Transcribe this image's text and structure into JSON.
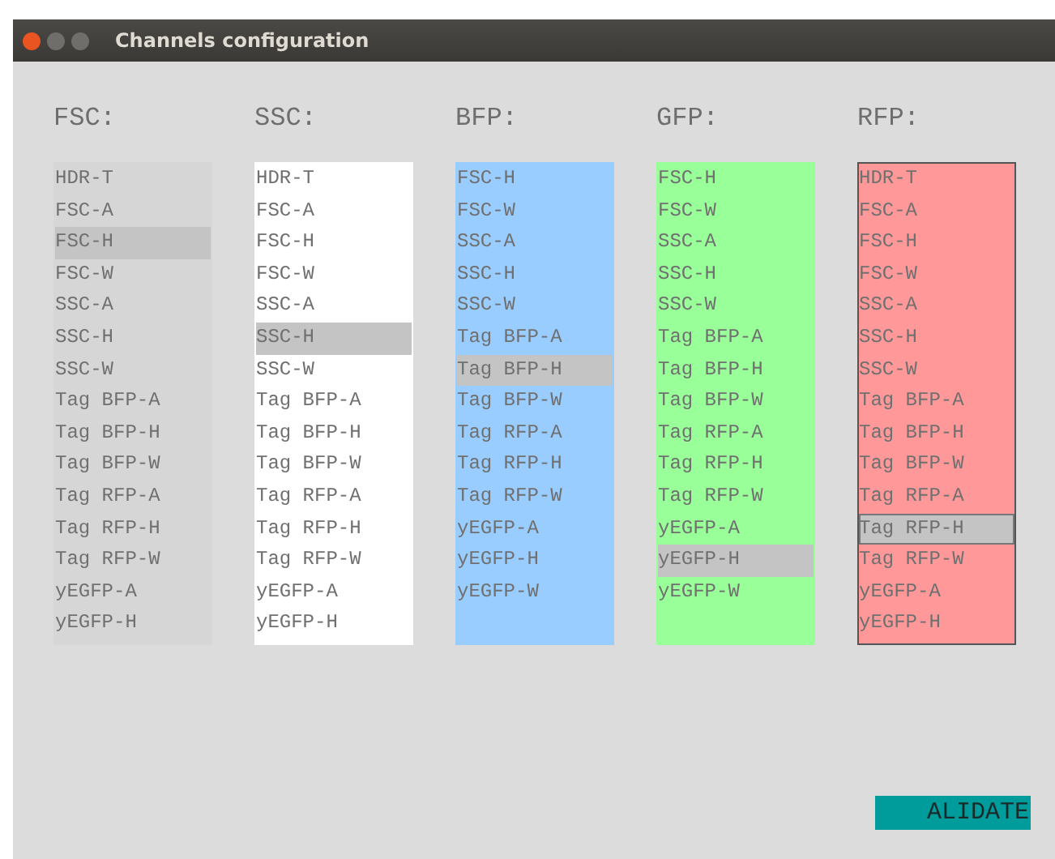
{
  "window": {
    "title": "Channels configuration"
  },
  "lists": [
    {
      "header": "FSC:",
      "color": "#d6d6d6",
      "focused": false,
      "items": [
        {
          "label": "HDR-T",
          "selected": false
        },
        {
          "label": "FSC-A",
          "selected": false
        },
        {
          "label": "FSC-H",
          "selected": true
        },
        {
          "label": "FSC-W",
          "selected": false
        },
        {
          "label": "SSC-A",
          "selected": false
        },
        {
          "label": "SSC-H",
          "selected": false
        },
        {
          "label": "SSC-W",
          "selected": false
        },
        {
          "label": "Tag BFP-A",
          "selected": false
        },
        {
          "label": "Tag BFP-H",
          "selected": false
        },
        {
          "label": "Tag BFP-W",
          "selected": false
        },
        {
          "label": "Tag RFP-A",
          "selected": false
        },
        {
          "label": "Tag RFP-H",
          "selected": false
        },
        {
          "label": "Tag RFP-W",
          "selected": false
        },
        {
          "label": "yEGFP-A",
          "selected": false
        },
        {
          "label": "yEGFP-H",
          "selected": false
        }
      ]
    },
    {
      "header": "SSC:",
      "color": "#ffffff",
      "focused": false,
      "items": [
        {
          "label": "HDR-T",
          "selected": false
        },
        {
          "label": "FSC-A",
          "selected": false
        },
        {
          "label": "FSC-H",
          "selected": false
        },
        {
          "label": "FSC-W",
          "selected": false
        },
        {
          "label": "SSC-A",
          "selected": false
        },
        {
          "label": "SSC-H",
          "selected": true
        },
        {
          "label": "SSC-W",
          "selected": false
        },
        {
          "label": "Tag BFP-A",
          "selected": false
        },
        {
          "label": "Tag BFP-H",
          "selected": false
        },
        {
          "label": "Tag BFP-W",
          "selected": false
        },
        {
          "label": "Tag RFP-A",
          "selected": false
        },
        {
          "label": "Tag RFP-H",
          "selected": false
        },
        {
          "label": "Tag RFP-W",
          "selected": false
        },
        {
          "label": "yEGFP-A",
          "selected": false
        },
        {
          "label": "yEGFP-H",
          "selected": false
        }
      ]
    },
    {
      "header": "BFP:",
      "color": "#99ccff",
      "focused": false,
      "items": [
        {
          "label": "FSC-H",
          "selected": false
        },
        {
          "label": "FSC-W",
          "selected": false
        },
        {
          "label": "SSC-A",
          "selected": false
        },
        {
          "label": "SSC-H",
          "selected": false
        },
        {
          "label": "SSC-W",
          "selected": false
        },
        {
          "label": "Tag BFP-A",
          "selected": false
        },
        {
          "label": "Tag BFP-H",
          "selected": true
        },
        {
          "label": "Tag BFP-W",
          "selected": false
        },
        {
          "label": "Tag RFP-A",
          "selected": false
        },
        {
          "label": "Tag RFP-H",
          "selected": false
        },
        {
          "label": "Tag RFP-W",
          "selected": false
        },
        {
          "label": "yEGFP-A",
          "selected": false
        },
        {
          "label": "yEGFP-H",
          "selected": false
        },
        {
          "label": "yEGFP-W",
          "selected": false
        }
      ]
    },
    {
      "header": "GFP:",
      "color": "#99ff99",
      "focused": false,
      "items": [
        {
          "label": "FSC-H",
          "selected": false
        },
        {
          "label": "FSC-W",
          "selected": false
        },
        {
          "label": "SSC-A",
          "selected": false
        },
        {
          "label": "SSC-H",
          "selected": false
        },
        {
          "label": "SSC-W",
          "selected": false
        },
        {
          "label": "Tag BFP-A",
          "selected": false
        },
        {
          "label": "Tag BFP-H",
          "selected": false
        },
        {
          "label": "Tag BFP-W",
          "selected": false
        },
        {
          "label": "Tag RFP-A",
          "selected": false
        },
        {
          "label": "Tag RFP-H",
          "selected": false
        },
        {
          "label": "Tag RFP-W",
          "selected": false
        },
        {
          "label": "yEGFP-A",
          "selected": false
        },
        {
          "label": "yEGFP-H",
          "selected": true
        },
        {
          "label": "yEGFP-W",
          "selected": false
        }
      ]
    },
    {
      "header": "RFP:",
      "color": "#ff9999",
      "focused": true,
      "items": [
        {
          "label": "HDR-T",
          "selected": false
        },
        {
          "label": "FSC-A",
          "selected": false
        },
        {
          "label": "FSC-H",
          "selected": false
        },
        {
          "label": "FSC-W",
          "selected": false
        },
        {
          "label": "SSC-A",
          "selected": false
        },
        {
          "label": "SSC-H",
          "selected": false
        },
        {
          "label": "SSC-W",
          "selected": false
        },
        {
          "label": "Tag BFP-A",
          "selected": false
        },
        {
          "label": "Tag BFP-H",
          "selected": false
        },
        {
          "label": "Tag BFP-W",
          "selected": false
        },
        {
          "label": "Tag RFP-A",
          "selected": false
        },
        {
          "label": "Tag RFP-H",
          "selected": true
        },
        {
          "label": "Tag RFP-W",
          "selected": false
        },
        {
          "label": "yEGFP-A",
          "selected": false
        },
        {
          "label": "yEGFP-H",
          "selected": false
        }
      ]
    }
  ],
  "validate_button": "ALIDATE"
}
